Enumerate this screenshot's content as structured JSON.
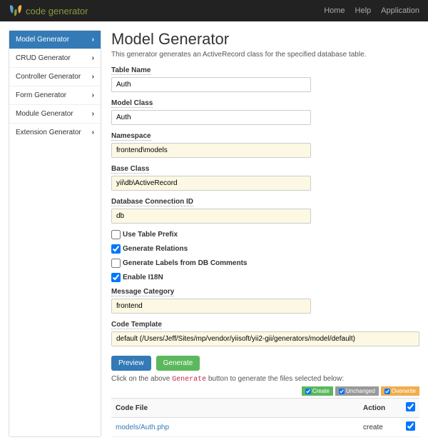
{
  "navbar": {
    "brand": "code generator",
    "links": [
      "Home",
      "Help",
      "Application"
    ]
  },
  "sidebar": {
    "items": [
      {
        "label": "Model Generator",
        "active": true
      },
      {
        "label": "CRUD Generator",
        "active": false
      },
      {
        "label": "Controller Generator",
        "active": false
      },
      {
        "label": "Form Generator",
        "active": false
      },
      {
        "label": "Module Generator",
        "active": false
      },
      {
        "label": "Extension Generator",
        "active": false
      }
    ]
  },
  "page": {
    "title": "Model Generator",
    "desc": "This generator generates an ActiveRecord class for the specified database table."
  },
  "form": {
    "tableName": {
      "label": "Table Name",
      "value": "Auth"
    },
    "modelClass": {
      "label": "Model Class",
      "value": "Auth"
    },
    "namespace": {
      "label": "Namespace",
      "value": "frontend\\models"
    },
    "baseClass": {
      "label": "Base Class",
      "value": "yii\\db\\ActiveRecord"
    },
    "dbConnection": {
      "label": "Database Connection ID",
      "value": "db"
    },
    "useTablePrefix": {
      "label": "Use Table Prefix",
      "checked": false
    },
    "generateRelations": {
      "label": "Generate Relations",
      "checked": true
    },
    "generateLabels": {
      "label": "Generate Labels from DB Comments",
      "checked": false
    },
    "enableI18N": {
      "label": "Enable I18N",
      "checked": true
    },
    "messageCategory": {
      "label": "Message Category",
      "value": "frontend"
    },
    "codeTemplate": {
      "label": "Code Template",
      "value": "default (/Users/Jeff/Sites/mp/vendor/yiisoft/yii2-gii/generators/model/default)"
    }
  },
  "buttons": {
    "preview": "Preview",
    "generate": "Generate"
  },
  "hint": {
    "prefix": "Click on the above ",
    "code": "Generate",
    "suffix": " button to generate the files selected below:"
  },
  "legend": {
    "create": "Create",
    "unchanged": "Unchanged",
    "overwrite": "Overwrite"
  },
  "table": {
    "headers": {
      "file": "Code File",
      "action": "Action"
    },
    "rows": [
      {
        "file": "models/Auth.php",
        "action": "create"
      }
    ]
  }
}
